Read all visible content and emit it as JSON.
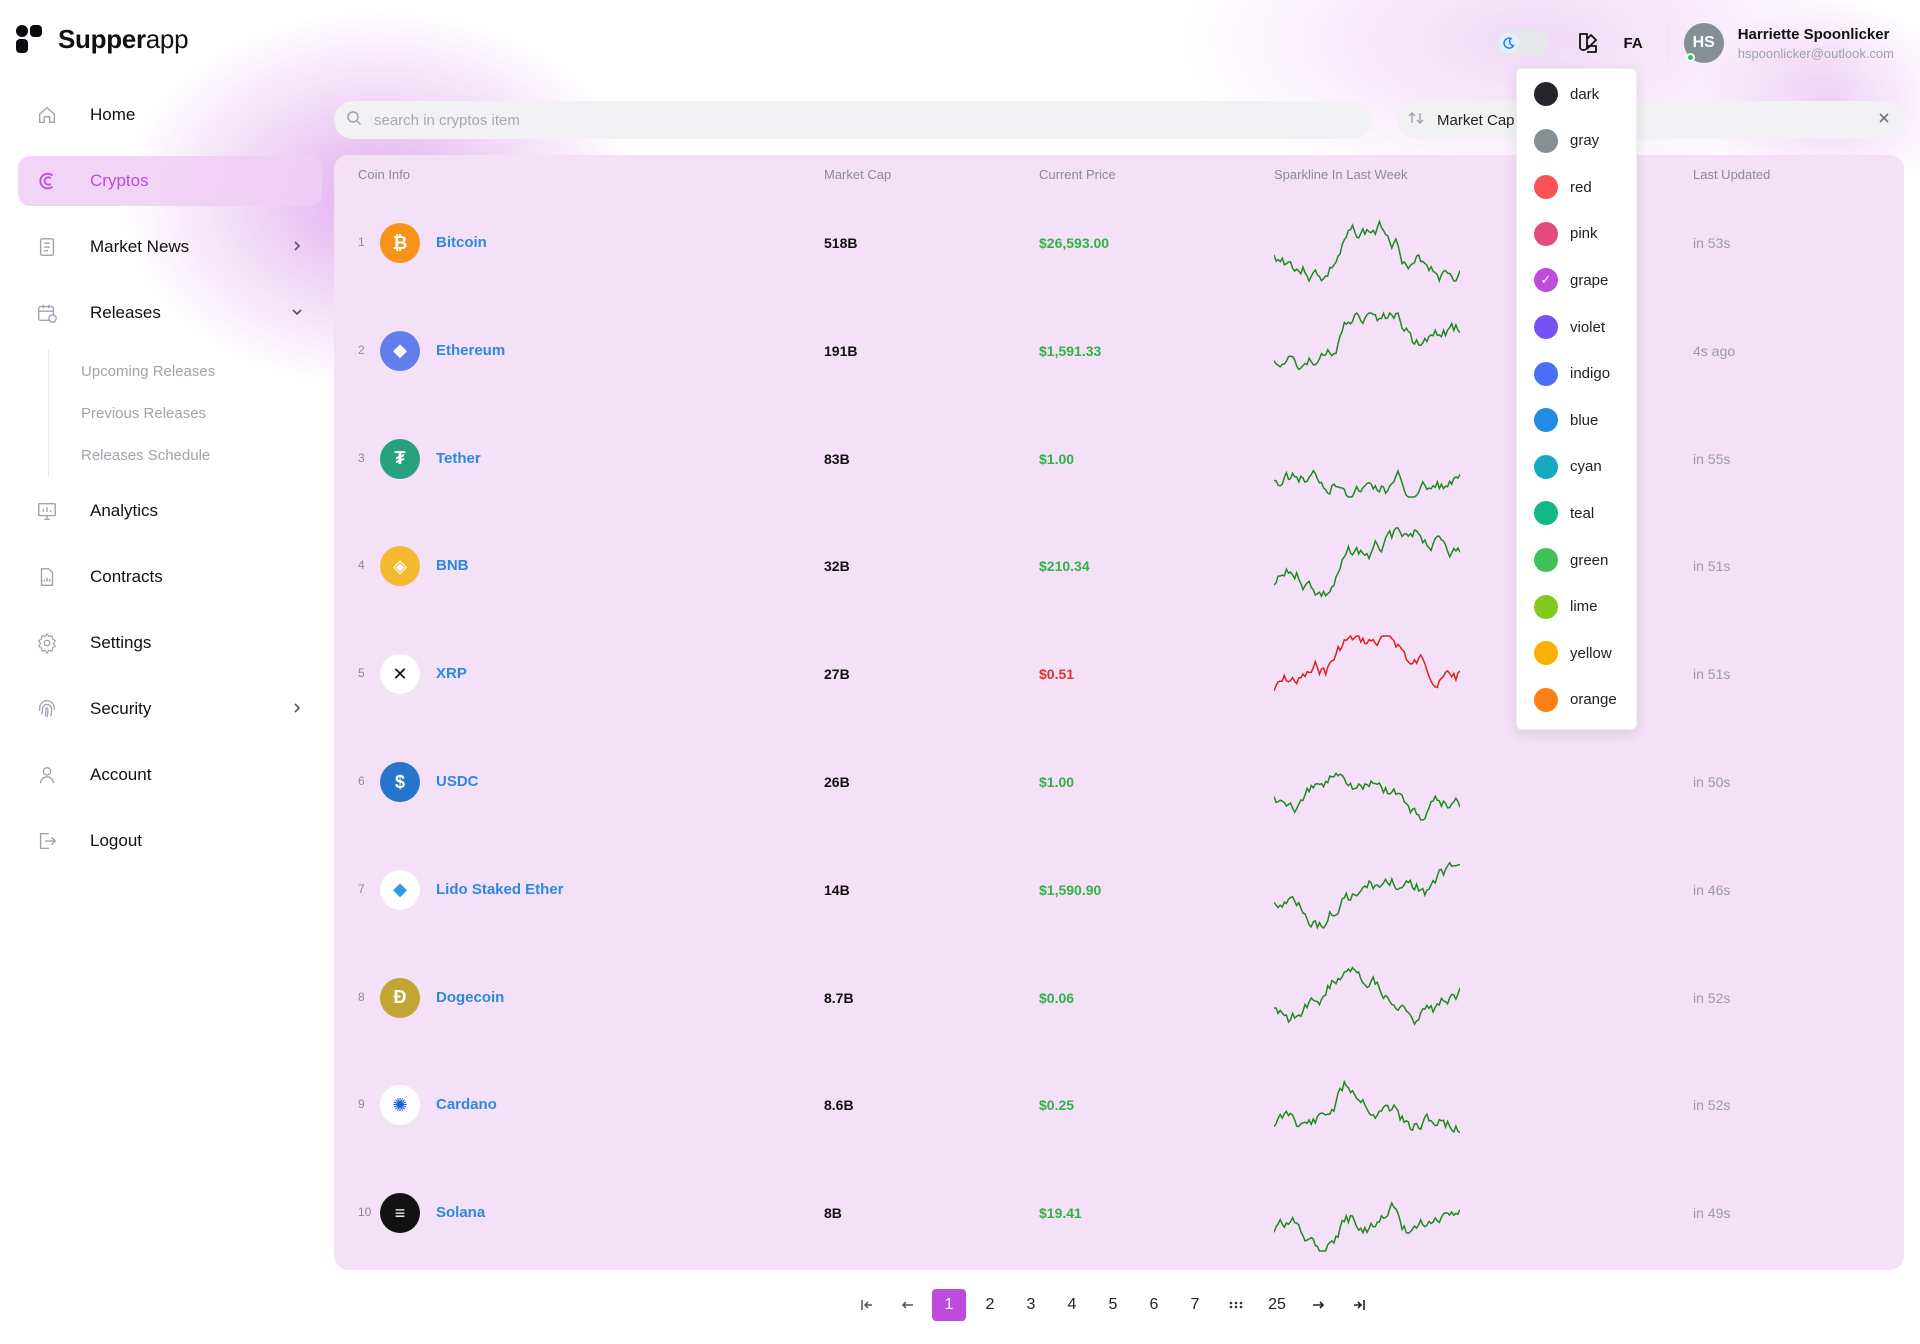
{
  "app": {
    "brand_bold": "Supper",
    "brand_light": "app"
  },
  "header": {
    "lang": "FA",
    "user": {
      "initials": "HS",
      "name": "Harriette Spoonlicker",
      "email": "hspoonlicker@outlook.com"
    }
  },
  "sidebar": {
    "items": [
      {
        "label": "Home",
        "icon": "home-icon"
      },
      {
        "label": "Cryptos",
        "icon": "crypto-icon",
        "active": true
      },
      {
        "label": "Market News",
        "icon": "news-icon",
        "chevron": "right"
      },
      {
        "label": "Releases",
        "icon": "calendar-icon",
        "chevron": "down"
      },
      {
        "label": "Analytics",
        "icon": "analytics-icon"
      },
      {
        "label": "Contracts",
        "icon": "contract-icon"
      },
      {
        "label": "Settings",
        "icon": "gear-icon"
      },
      {
        "label": "Security",
        "icon": "fingerprint-icon",
        "chevron": "right"
      },
      {
        "label": "Account",
        "icon": "user-icon"
      },
      {
        "label": "Logout",
        "icon": "logout-icon"
      }
    ],
    "releases_sub": [
      "Upcoming Releases",
      "Previous Releases",
      "Releases Schedule"
    ]
  },
  "search": {
    "placeholder": "search in cryptos item"
  },
  "sort": {
    "label": "Market Cap"
  },
  "table": {
    "headers": [
      "Coin Info",
      "Market Cap",
      "Current Price",
      "Sparkline In Last Week",
      "Last Updated"
    ],
    "rows": [
      {
        "rank": "1",
        "name": "Bitcoin",
        "market_cap": "518B",
        "price": "$26,593.00",
        "trend": "up",
        "updated": "in 53s",
        "icon_color": "#f7931a"
      },
      {
        "rank": "2",
        "name": "Ethereum",
        "market_cap": "191B",
        "price": "$1,591.33",
        "trend": "up",
        "updated": "4s ago",
        "icon_color": "#627eea"
      },
      {
        "rank": "3",
        "name": "Tether",
        "market_cap": "83B",
        "price": "$1.00",
        "trend": "up",
        "updated": "in 55s",
        "icon_color": "#26a17b"
      },
      {
        "rank": "4",
        "name": "BNB",
        "market_cap": "32B",
        "price": "$210.34",
        "trend": "up",
        "updated": "in 51s",
        "icon_color": "#f3ba2f"
      },
      {
        "rank": "5",
        "name": "XRP",
        "market_cap": "27B",
        "price": "$0.51",
        "trend": "down",
        "updated": "in 51s",
        "icon_color": "#ffffff"
      },
      {
        "rank": "6",
        "name": "USDC",
        "market_cap": "26B",
        "price": "$1.00",
        "trend": "up",
        "updated": "in 50s",
        "icon_color": "#2775ca"
      },
      {
        "rank": "7",
        "name": "Lido Staked Ether",
        "market_cap": "14B",
        "price": "$1,590.90",
        "trend": "up",
        "updated": "in 46s",
        "icon_color": "#ffffff"
      },
      {
        "rank": "8",
        "name": "Dogecoin",
        "market_cap": "8.7B",
        "price": "$0.06",
        "trend": "up",
        "updated": "in 52s",
        "icon_color": "#c2a633"
      },
      {
        "rank": "9",
        "name": "Cardano",
        "market_cap": "8.6B",
        "price": "$0.25",
        "trend": "up",
        "updated": "in 52s",
        "icon_color": "#ffffff"
      },
      {
        "rank": "10",
        "name": "Solana",
        "market_cap": "8B",
        "price": "$19.41",
        "trend": "up",
        "updated": "in 49s",
        "icon_color": "#111111"
      }
    ]
  },
  "colors": {
    "accent": "#be4bdb",
    "positive": "#2fb344",
    "negative": "#e03131",
    "link": "#2b8ae0"
  },
  "color_menu": {
    "options": [
      {
        "name": "dark",
        "color": "#25262b"
      },
      {
        "name": "gray",
        "color": "#868e96"
      },
      {
        "name": "red",
        "color": "#fa5252"
      },
      {
        "name": "pink",
        "color": "#e64980"
      },
      {
        "name": "grape",
        "color": "#be4bdb",
        "selected": true
      },
      {
        "name": "violet",
        "color": "#7950f2"
      },
      {
        "name": "indigo",
        "color": "#4c6ef5"
      },
      {
        "name": "blue",
        "color": "#228be6"
      },
      {
        "name": "cyan",
        "color": "#15aabf"
      },
      {
        "name": "teal",
        "color": "#12b886"
      },
      {
        "name": "green",
        "color": "#40c057"
      },
      {
        "name": "lime",
        "color": "#82c91e"
      },
      {
        "name": "yellow",
        "color": "#fab005"
      },
      {
        "name": "orange",
        "color": "#fd7e14"
      }
    ]
  },
  "pagination": {
    "pages": [
      "1",
      "2",
      "3",
      "4",
      "5",
      "6",
      "7",
      "25"
    ],
    "current": "1"
  }
}
